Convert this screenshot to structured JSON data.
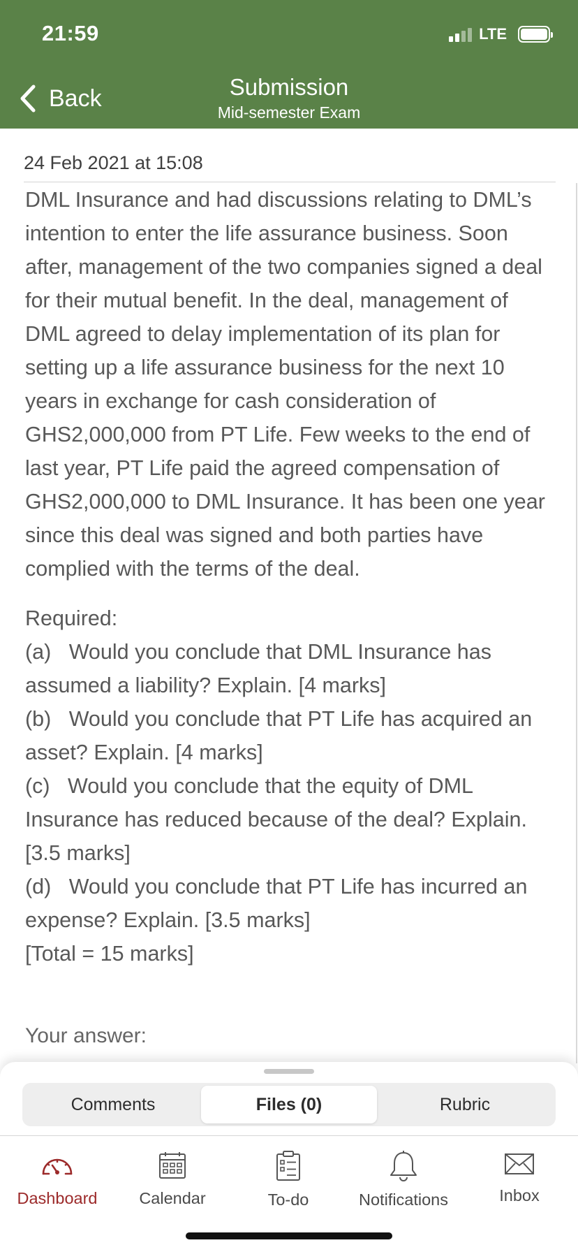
{
  "status_bar": {
    "time": "21:59",
    "network": "LTE"
  },
  "nav": {
    "back_label": "Back",
    "title": "Submission",
    "subtitle": "Mid-semester Exam"
  },
  "submission": {
    "date": "24 Feb 2021 at 15:08",
    "paragraph": "DML Insurance and had discussions relating to DML’s intention to enter the life assurance business. Soon after, management of the two companies signed a deal for their mutual benefit. In the deal, management of DML agreed to delay implementation of its plan for setting up a life assurance business for the next 10 years in exchange for cash consideration of GHS2,000,000 from PT Life. Few weeks to the end of last year, PT Life paid the agreed compensation of GHS2,000,000 to DML Insurance. It has been one year since this deal was signed and both parties have complied with the terms of the deal.",
    "required_label": "Required:",
    "questions": [
      "(a)   Would you conclude that DML Insurance has assumed a liability? Explain. [4 marks]",
      "(b)   Would you conclude that PT Life has acquired an asset? Explain. [4 marks]",
      "(c)   Would you conclude that the equity of DML Insurance has reduced because of the deal? Explain. [3.5 marks]",
      "(d)   Would you conclude that PT Life has incurred an expense? Explain. [3.5 marks]"
    ],
    "total": "[Total = 15 marks]",
    "answer_label": "Your answer:"
  },
  "sheet_tabs": [
    {
      "label": "Comments",
      "active": false
    },
    {
      "label": "Files (0)",
      "active": true
    },
    {
      "label": "Rubric",
      "active": false
    }
  ],
  "tab_bar": [
    {
      "label": "Dashboard",
      "icon": "dashboard-icon",
      "active": true
    },
    {
      "label": "Calendar",
      "icon": "calendar-icon",
      "active": false
    },
    {
      "label": "To-do",
      "icon": "todo-icon",
      "active": false
    },
    {
      "label": "Notifications",
      "icon": "bell-icon",
      "active": false
    },
    {
      "label": "Inbox",
      "icon": "envelope-icon",
      "active": false
    }
  ],
  "colors": {
    "header": "#5a8248",
    "active_tab": "#9c2a2a"
  }
}
